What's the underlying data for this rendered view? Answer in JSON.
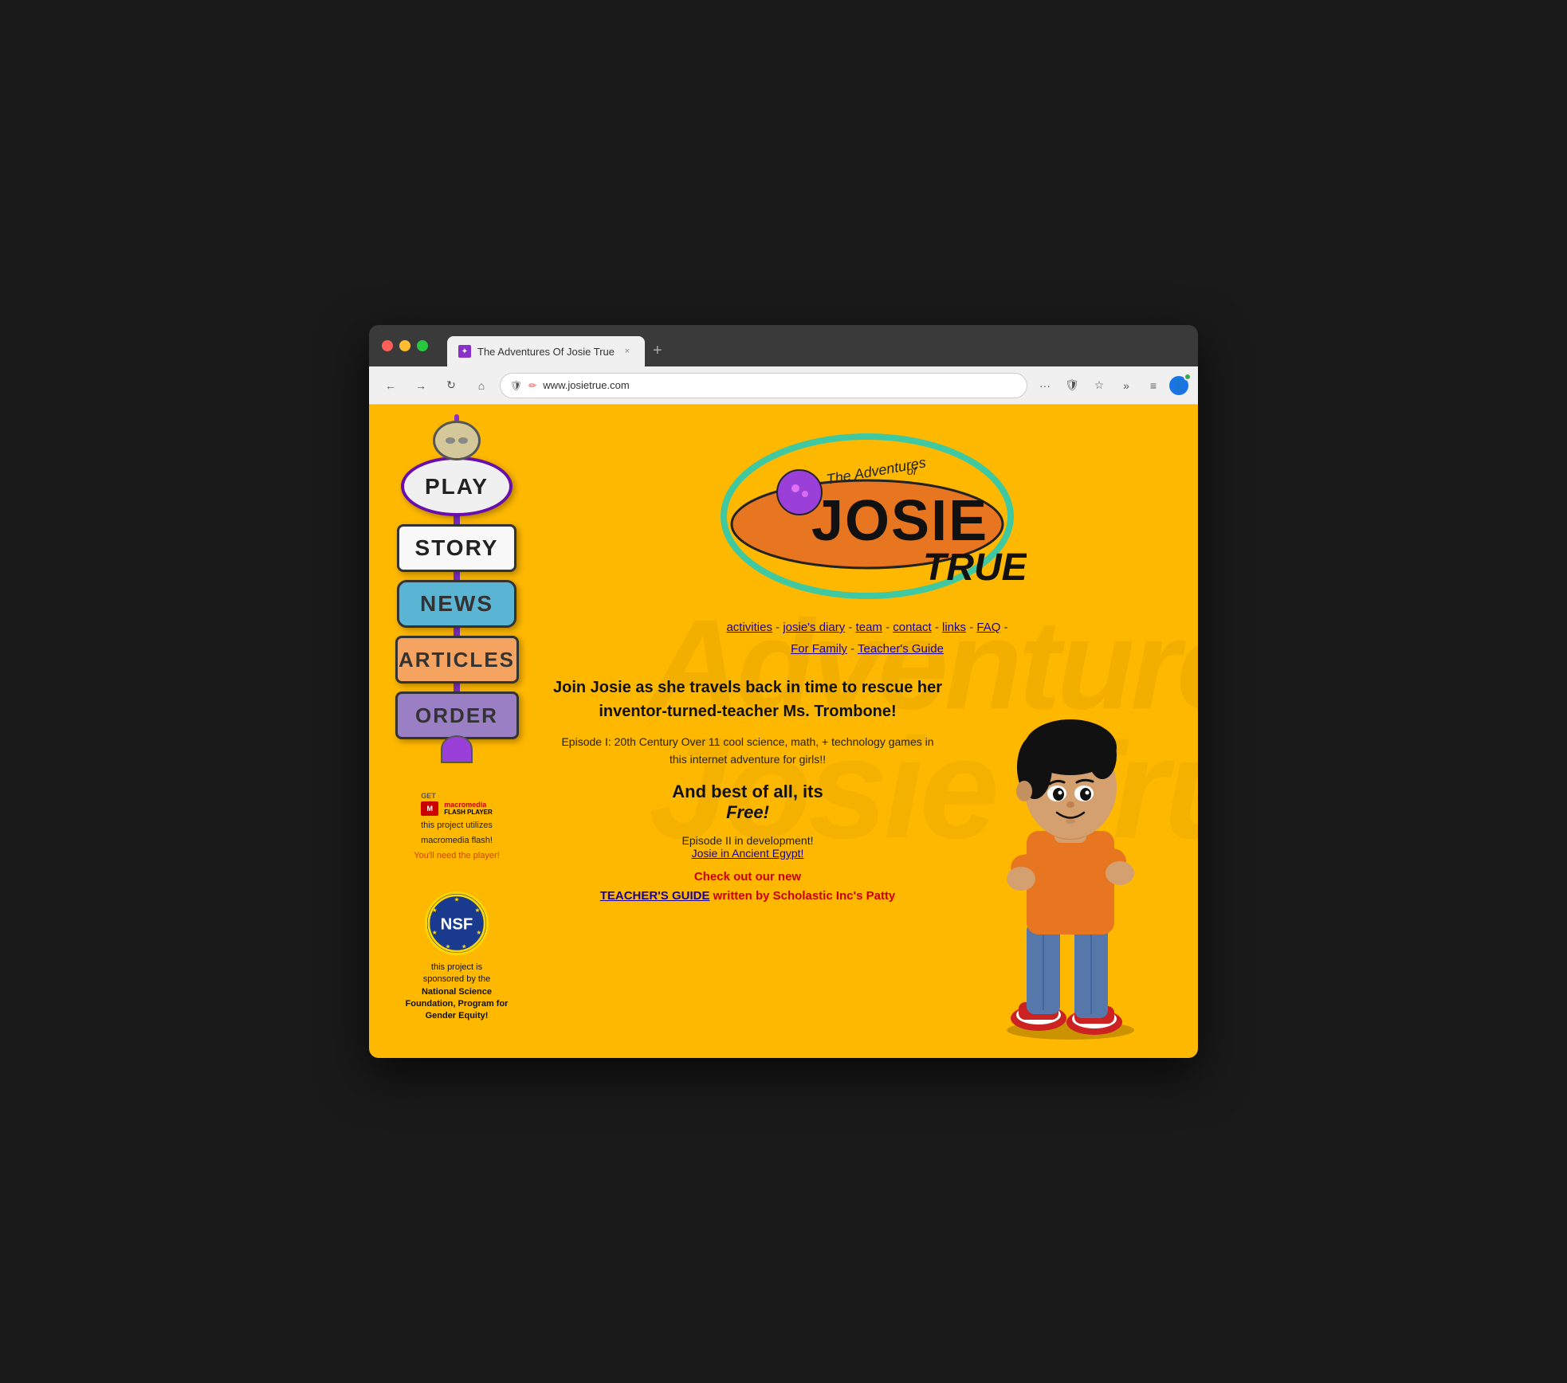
{
  "browser": {
    "window_controls": [
      "red",
      "yellow",
      "green"
    ],
    "tab": {
      "favicon_text": "✦",
      "title": "The Adventures Of Josie True",
      "close_label": "×"
    },
    "new_tab_label": "+",
    "nav": {
      "back_icon": "←",
      "forward_icon": "→",
      "refresh_icon": "↻",
      "home_icon": "⌂",
      "url": "www.josietrue.com",
      "more_icon": "···",
      "shield_icon": "🛡",
      "bookmark_icon": "☆",
      "extensions_icon": "»",
      "menu_icon": "≡"
    }
  },
  "page": {
    "watermark_text": "Josie True",
    "sidebar": {
      "nav_items": [
        {
          "label": "PLAY",
          "key": "play"
        },
        {
          "label": "STORY",
          "key": "story"
        },
        {
          "label": "NEWS",
          "key": "news"
        },
        {
          "label": "ARTICLES",
          "key": "articles"
        },
        {
          "label": "ORDER",
          "key": "order"
        }
      ],
      "flash_get_label": "GET",
      "flash_macromedia": "macromedia",
      "flash_player": "FLASH PLAYER",
      "flash_caption_line1": "this project utilizes",
      "flash_caption_line2": "macromedia flash!",
      "flash_caption_line3": "You'll need the player!",
      "nsf_label": "NSF",
      "nsf_caption_line1": "this project is",
      "nsf_caption_line2": "sponsored by the",
      "nsf_caption_bold": "National Science Foundation, Program for Gender Equity!"
    },
    "main": {
      "logo_title": "The Adventures of Josie True",
      "nav_links": [
        {
          "label": "activities",
          "href": "#activities"
        },
        {
          "label": "josie's diary",
          "href": "#diary"
        },
        {
          "label": "team",
          "href": "#team"
        },
        {
          "label": "contact",
          "href": "#contact"
        },
        {
          "label": "links",
          "href": "#links"
        },
        {
          "label": "FAQ",
          "href": "#faq"
        },
        {
          "label": "For Family",
          "href": "#family"
        },
        {
          "label": "Teacher's Guide",
          "href": "#teachers-guide"
        }
      ],
      "nav_separators": [
        " - ",
        " - ",
        " - ",
        " - ",
        " - ",
        "-",
        " - "
      ],
      "hero_text": "Join Josie as she travels back in time to rescue her inventor-turned-teacher Ms. Trombone!",
      "sub_text": "Episode I: 20th Century Over 11 cool science, math, + technology games in this internet adventure for girls!!",
      "free_heading": "And best of all, its",
      "free_label": "Free!",
      "episode2_text": "Episode II in development!",
      "episode2_link_label": "Josie in Ancient Egypt!",
      "teacher_promo_line1": "Check out our new",
      "teacher_promo_link": "TEACHER'S GUIDE",
      "teacher_promo_line2": "written by Scholastic Inc's Patty"
    }
  }
}
